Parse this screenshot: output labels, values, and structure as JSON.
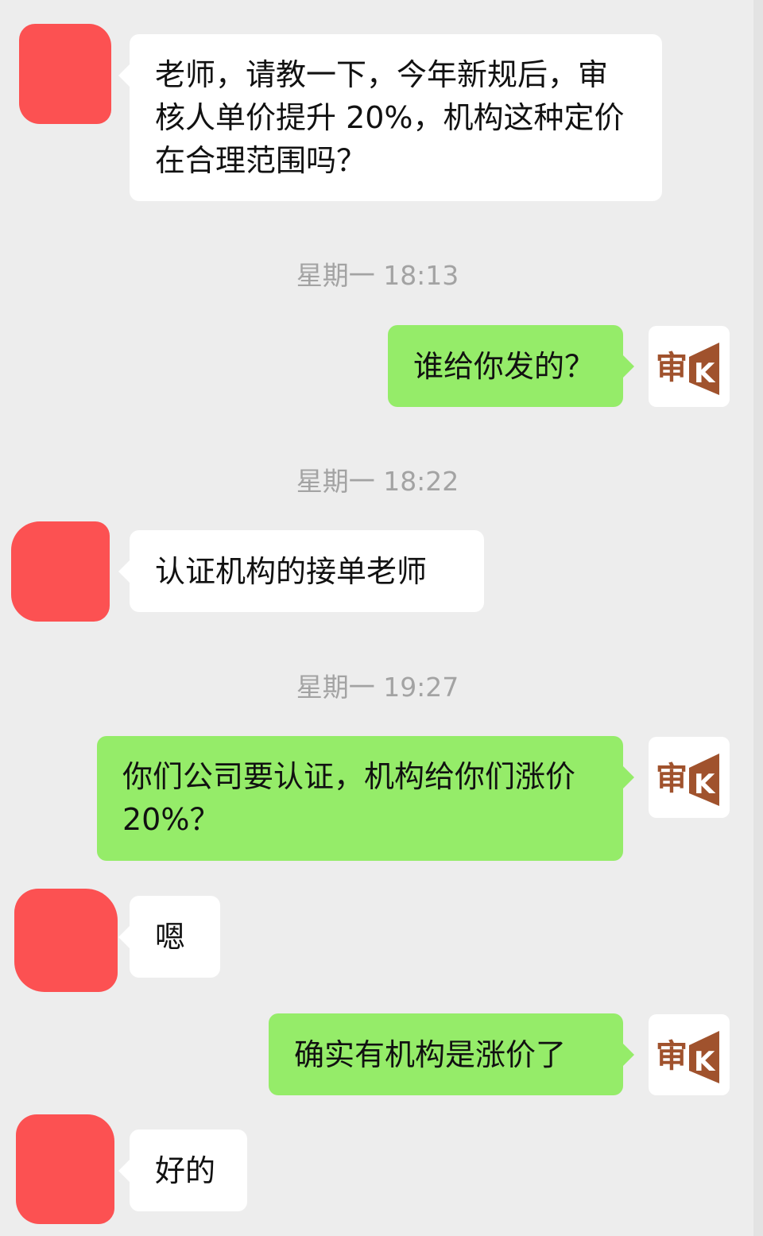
{
  "colors": {
    "page_background": "#ededed",
    "incoming_bubble": "#ffffff",
    "outgoing_bubble": "#95ec69",
    "redacted_avatar": "#fc5152",
    "timestamp_text": "#a3a3a3",
    "logo_brown": "#a0522d"
  },
  "self_avatar": {
    "icon": "shen-k-logo-icon",
    "logo_char": "审",
    "logo_letter": "K"
  },
  "messages": [
    {
      "side": "incoming",
      "text": "老师，请教一下，今年新规后，审核人单价提升 20%，机构这种定价在合理范围吗？"
    },
    {
      "type": "timestamp",
      "text": "星期一 18:13"
    },
    {
      "side": "outgoing",
      "text": "谁给你发的？"
    },
    {
      "type": "timestamp",
      "text": "星期一 18:22"
    },
    {
      "side": "incoming",
      "text": "认证机构的接单老师"
    },
    {
      "type": "timestamp",
      "text": "星期一 19:27"
    },
    {
      "side": "outgoing",
      "text": "你们公司要认证，机构给你们涨价 20%？"
    },
    {
      "side": "incoming",
      "text": "嗯"
    },
    {
      "side": "outgoing",
      "text": "确实有机构是涨价了"
    },
    {
      "side": "incoming",
      "text": "好的"
    }
  ]
}
